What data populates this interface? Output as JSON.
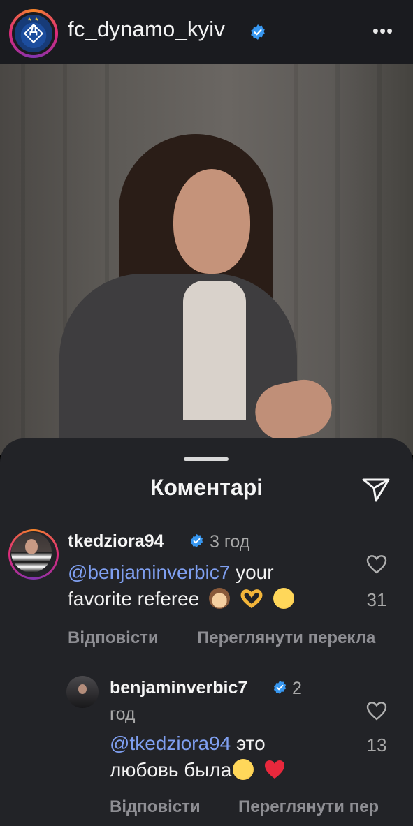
{
  "header": {
    "account_name": "fc_dynamo_kyiv",
    "logo_letter": "Д",
    "logo_stars": "★ ★"
  },
  "sheet": {
    "title": "Коментарі"
  },
  "comments": [
    {
      "username": "tkedziora94",
      "time": "3 год",
      "mention": "@benjaminverbic7",
      "text_line1": " your",
      "text_line2": "favorite referee",
      "emojis": [
        "see-no-evil-monkey",
        "heart-hands",
        "grinning-sweat"
      ],
      "likes": "31",
      "reply_label": "Відповісти",
      "translate_label": "Переглянути перекла"
    },
    {
      "username": "benjaminverbic7",
      "time_part1": "2",
      "time_part2": "год",
      "mention": "@tkedziora94",
      "text_line1": " это",
      "text_line2": "любовь была",
      "emojis": [
        "grinning-sweat",
        "red-heart"
      ],
      "likes": "13",
      "reply_label": "Відповісти",
      "translate_label": "Переглянути пер"
    }
  ],
  "colors": {
    "verified": "#3797f0",
    "mention": "#7f9ff0",
    "sheet_bg": "#222327"
  }
}
